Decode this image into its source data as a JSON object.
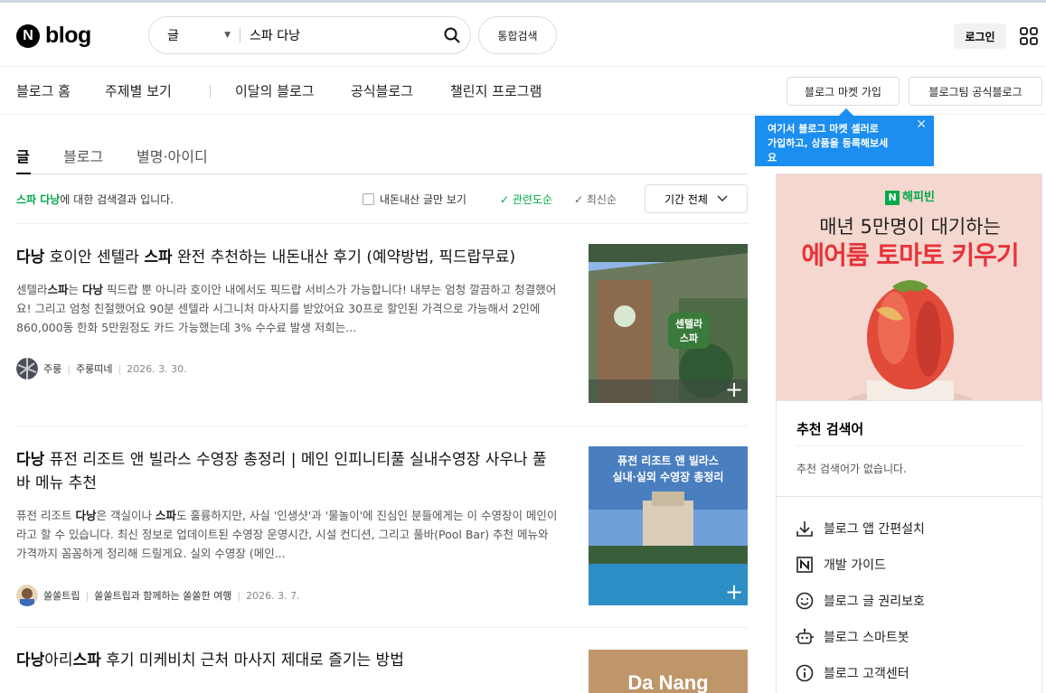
{
  "header": {
    "logo_letter": "N",
    "logo_text": "blog",
    "search_type": "글",
    "search_query": "스파 다낭",
    "integrated_search": "통합검색",
    "login": "로그인"
  },
  "nav": {
    "items": [
      "블로그 홈",
      "주제별 보기",
      "이달의 블로그",
      "공식블로그",
      "챌린지 프로그램"
    ],
    "market_join": "블로그 마켓 가입",
    "official_blog": "블로그팀 공식블로그"
  },
  "tooltip": {
    "line1": "여기서 블로그 마켓 셀러로",
    "line2": "가입하고, 상품을 등록해보세",
    "line3": "요"
  },
  "tabs": [
    "글",
    "블로그",
    "별명·아이디"
  ],
  "result_bar": {
    "keyword": "스파 다낭",
    "suffix": "에 대한 검색결과 입니다.",
    "filter_label": "내돈내산 글만 보기",
    "sort_relevance": "관련도순",
    "sort_recent": "최신순",
    "period": "기간 전체"
  },
  "articles": [
    {
      "title_parts": [
        {
          "t": "다낭",
          "b": true
        },
        {
          "t": " 호이안 센텔라 ",
          "b": false
        },
        {
          "t": "스파",
          "b": true
        },
        {
          "t": " 완전 추천하는 내돈내산 후기 (예약방법, 픽드랍무료)",
          "b": false
        }
      ],
      "desc_parts": [
        {
          "t": "센텔라",
          "b": false
        },
        {
          "t": "스파",
          "b": true
        },
        {
          "t": "는 ",
          "b": false
        },
        {
          "t": "다낭",
          "b": true
        },
        {
          "t": " 픽드랍 뿐 아니라 호이안 내에서도 픽드랍 서비스가 가능합니다! 내부는 엄청 깔끔하고 청결했어요! 그리고 엄청 친절했어요 90분 센텔라 시그니처 마사지를 받았어요 30프로 할인된 가격으로 가능해서 2인에 860,000동 한화 5만원정도 카드 가능했는데 3% 수수료 발생 저희는...",
          "b": false
        }
      ],
      "author": "주룽",
      "blog": "주룽띠네",
      "date": "2026. 3. 30.",
      "thumb_text": "센텔라 스파"
    },
    {
      "title_parts": [
        {
          "t": "다낭",
          "b": true
        },
        {
          "t": " 퓨전 리조트 앤 빌라스 수영장 총정리 | 메인 인피니티풀 실내수영장 사우나 풀바 메뉴 추천",
          "b": false
        }
      ],
      "desc_parts": [
        {
          "t": "퓨전 리조트 ",
          "b": false
        },
        {
          "t": "다낭",
          "b": true
        },
        {
          "t": "은 객실이나 ",
          "b": false
        },
        {
          "t": "스파",
          "b": true
        },
        {
          "t": "도 훌륭하지만, 사실 '인생샷'과 '물놀이'에 진심인 분들에게는 이 수영장이 메인이라고 할 수 있습니다. 최신 정보로 업데이트된 수영장 운영시간, 시설 컨디션, 그리고 풀바(Pool Bar) 추천 메뉴와 가격까지 꼼꼼하게 정리해 드릴게요. 실외 수영장 (메인...",
          "b": false
        }
      ],
      "author": "쏠쏠트립",
      "blog": "쏠쏠트립과 함께하는 쏠쏠한 여행",
      "date": "2026. 3. 7.",
      "thumb_line1": "퓨전 리조트 앤 빌라스",
      "thumb_line2": "실내·실외 수영장 총정리"
    },
    {
      "title_parts": [
        {
          "t": "다낭",
          "b": true
        },
        {
          "t": "아리",
          "b": false
        },
        {
          "t": "스파",
          "b": true
        },
        {
          "t": " 후기 미케비치 근처 마사지 제대로 즐기는 방법",
          "b": false
        }
      ],
      "thumb_text": "Da Nang"
    }
  ],
  "sidebar": {
    "ad_brand": "해피빈",
    "ad_brand_letter": "N",
    "ad_line1": "매년 5만명이 대기하는",
    "ad_line2": "에어룸 토마토 키우기",
    "recommend_title": "추천 검색어",
    "recommend_empty": "추천 검색어가 없습니다.",
    "links": [
      {
        "label": "블로그 앱 간편설치",
        "icon": "download-icon"
      },
      {
        "label": "개발 가이드",
        "icon": "naver-n-icon"
      },
      {
        "label": "블로그 글 권리보호",
        "icon": "smile-icon"
      },
      {
        "label": "블로그 스마트봇",
        "icon": "robot-icon"
      },
      {
        "label": "블로그 고객센터",
        "icon": "info-icon"
      }
    ]
  },
  "colors": {
    "green": "#03a94a",
    "tooltip_blue": "#1b8eef",
    "ad_red": "#e8333a"
  }
}
